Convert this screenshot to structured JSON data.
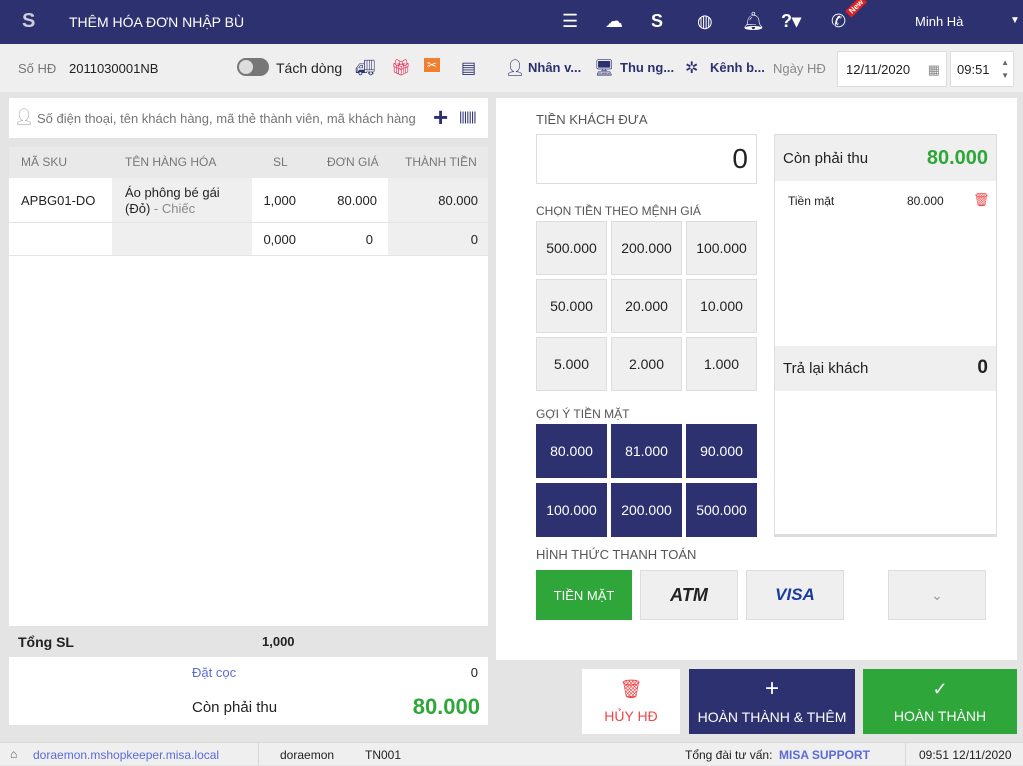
{
  "header": {
    "title": "THÊM HÓA ĐƠN NHẬP BÙ",
    "user": "Minh Hà",
    "new_badge": "New"
  },
  "toolbar": {
    "invoice_label": "Số HĐ",
    "invoice_no": "2011030001NB",
    "split_label": "Tách dòng",
    "staff": "Nhân v...",
    "cashier": "Thu ng...",
    "channel": "Kênh b...",
    "date_label": "Ngày HĐ",
    "date": "12/11/2020",
    "time": "09:51"
  },
  "search": {
    "placeholder": "Số điện thoại, tên khách hàng, mã thẻ thành viên, mã khách hàng"
  },
  "table": {
    "headers": [
      "MÃ SKU",
      "TÊN HÀNG HÓA",
      "SL",
      "ĐƠN GIÁ",
      "THÀNH TIỀN"
    ],
    "rows": [
      {
        "sku": "APBG01-DO",
        "name": "Áo phông bé gái (Đỏ)",
        "unit": " - Chiếc",
        "qty": "1,000",
        "price": "80.000",
        "total": "80.000"
      },
      {
        "sku": "",
        "name": "",
        "unit": "",
        "qty": "0,000",
        "price": "0",
        "total": "0"
      }
    ]
  },
  "summary": {
    "total_qty_label": "Tổng SL",
    "total_qty": "1,000",
    "deposit_label": "Đặt cọc",
    "deposit": "0",
    "due_label": "Còn phải thu",
    "due": "80.000"
  },
  "payment": {
    "given_label": "TIỀN KHÁCH ĐƯA",
    "given": "0",
    "denom_label": "CHỌN TIỀN THEO MỆNH GIÁ",
    "denoms": [
      "500.000",
      "200.000",
      "100.000",
      "50.000",
      "20.000",
      "10.000",
      "5.000",
      "2.000",
      "1.000"
    ],
    "suggest_label": "GỢI Ý TIỀN MẶT",
    "suggests": [
      "80.000",
      "81.000",
      "90.000",
      "100.000",
      "200.000",
      "500.000"
    ],
    "method_label": "HÌNH THỨC THANH TOÁN",
    "methods": [
      "TIỀN MẶT",
      "ATM",
      "VISA"
    ],
    "due_label": "Còn phải thu",
    "due": "80.000",
    "line_label": "Tiền mặt",
    "line_amount": "80.000",
    "change_label": "Trả lại khách",
    "change": "0"
  },
  "actions": {
    "cancel": "HỦY HĐ",
    "complete_add": "HOÀN THÀNH & THÊM",
    "complete": "HOÀN THÀNH"
  },
  "status": {
    "domain": "doraemon.mshopkeeper.misa.local",
    "user": "doraemon",
    "branch": "TN001",
    "hotline_label": "Tổng đài tư vấn:",
    "hotline": "MISA SUPPORT",
    "datetime": "09:51 12/11/2020"
  },
  "colors": {
    "navy": "#2d3170",
    "green": "#2ea63a",
    "red": "#f04747"
  }
}
